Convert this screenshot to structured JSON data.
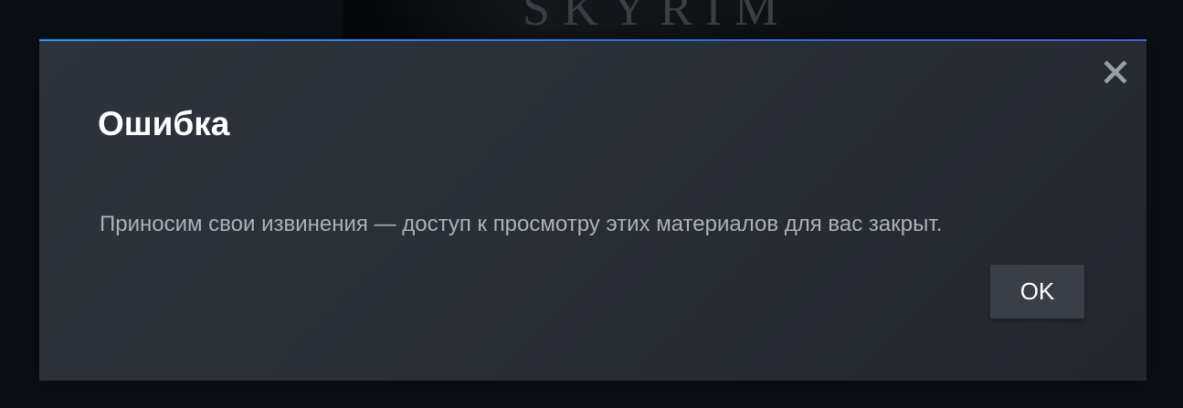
{
  "background": {
    "banner_text": "SKYRIM"
  },
  "dialog": {
    "title": "Ошибка",
    "message": "Приносим свои извинения — доступ к просмотру этих материалов для вас закрыт.",
    "ok_label": "OK",
    "close_icon": "close-icon"
  },
  "colors": {
    "dialog_background": "#2b2f36",
    "accent_line": "#1a9fff",
    "title_text": "#ffffff",
    "message_text": "#acb2b8",
    "button_background": "#3a3f47"
  }
}
